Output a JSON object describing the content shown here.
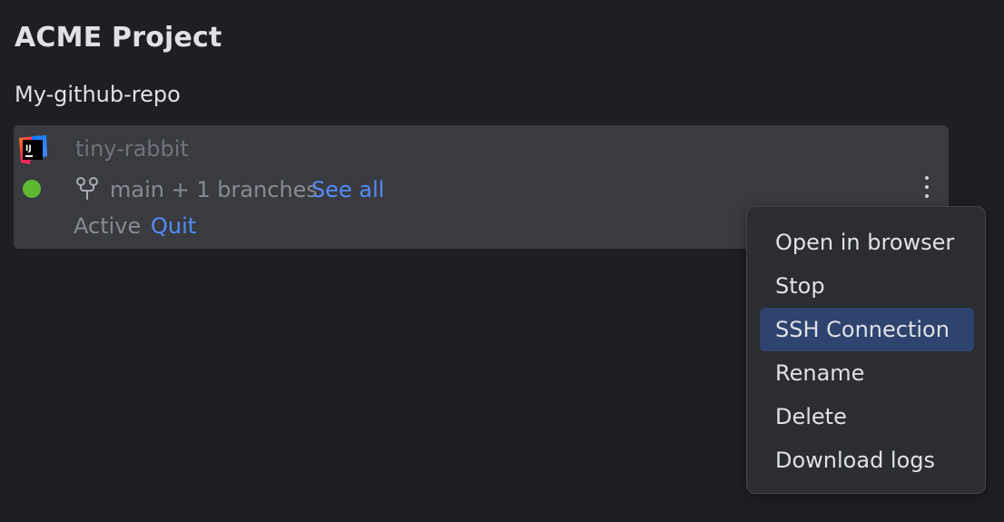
{
  "project": {
    "title": "ACME Project"
  },
  "repo": {
    "name": "My-github-repo"
  },
  "workspace": {
    "name": "tiny-rabbit",
    "ide_icon": "intellij-idea-icon",
    "status_color": "#5fb832",
    "branch_icon": "git-branch-icon",
    "branches_text": "main + 1 branches",
    "see_all": "See all",
    "status": "Active",
    "quit": "Quit",
    "more_icon": "vertical-ellipsis-icon"
  },
  "context_menu": {
    "items": [
      {
        "label": "Open in browser"
      },
      {
        "label": "Stop"
      },
      {
        "label": "SSH Connection",
        "selected": true
      },
      {
        "label": "Rename"
      },
      {
        "label": "Delete"
      },
      {
        "label": "Download logs"
      }
    ]
  },
  "colors": {
    "background": "#1e1f22",
    "card": "#393b40",
    "link": "#548af7",
    "menu_background": "#2b2d30",
    "menu_selected": "#2e436e"
  }
}
